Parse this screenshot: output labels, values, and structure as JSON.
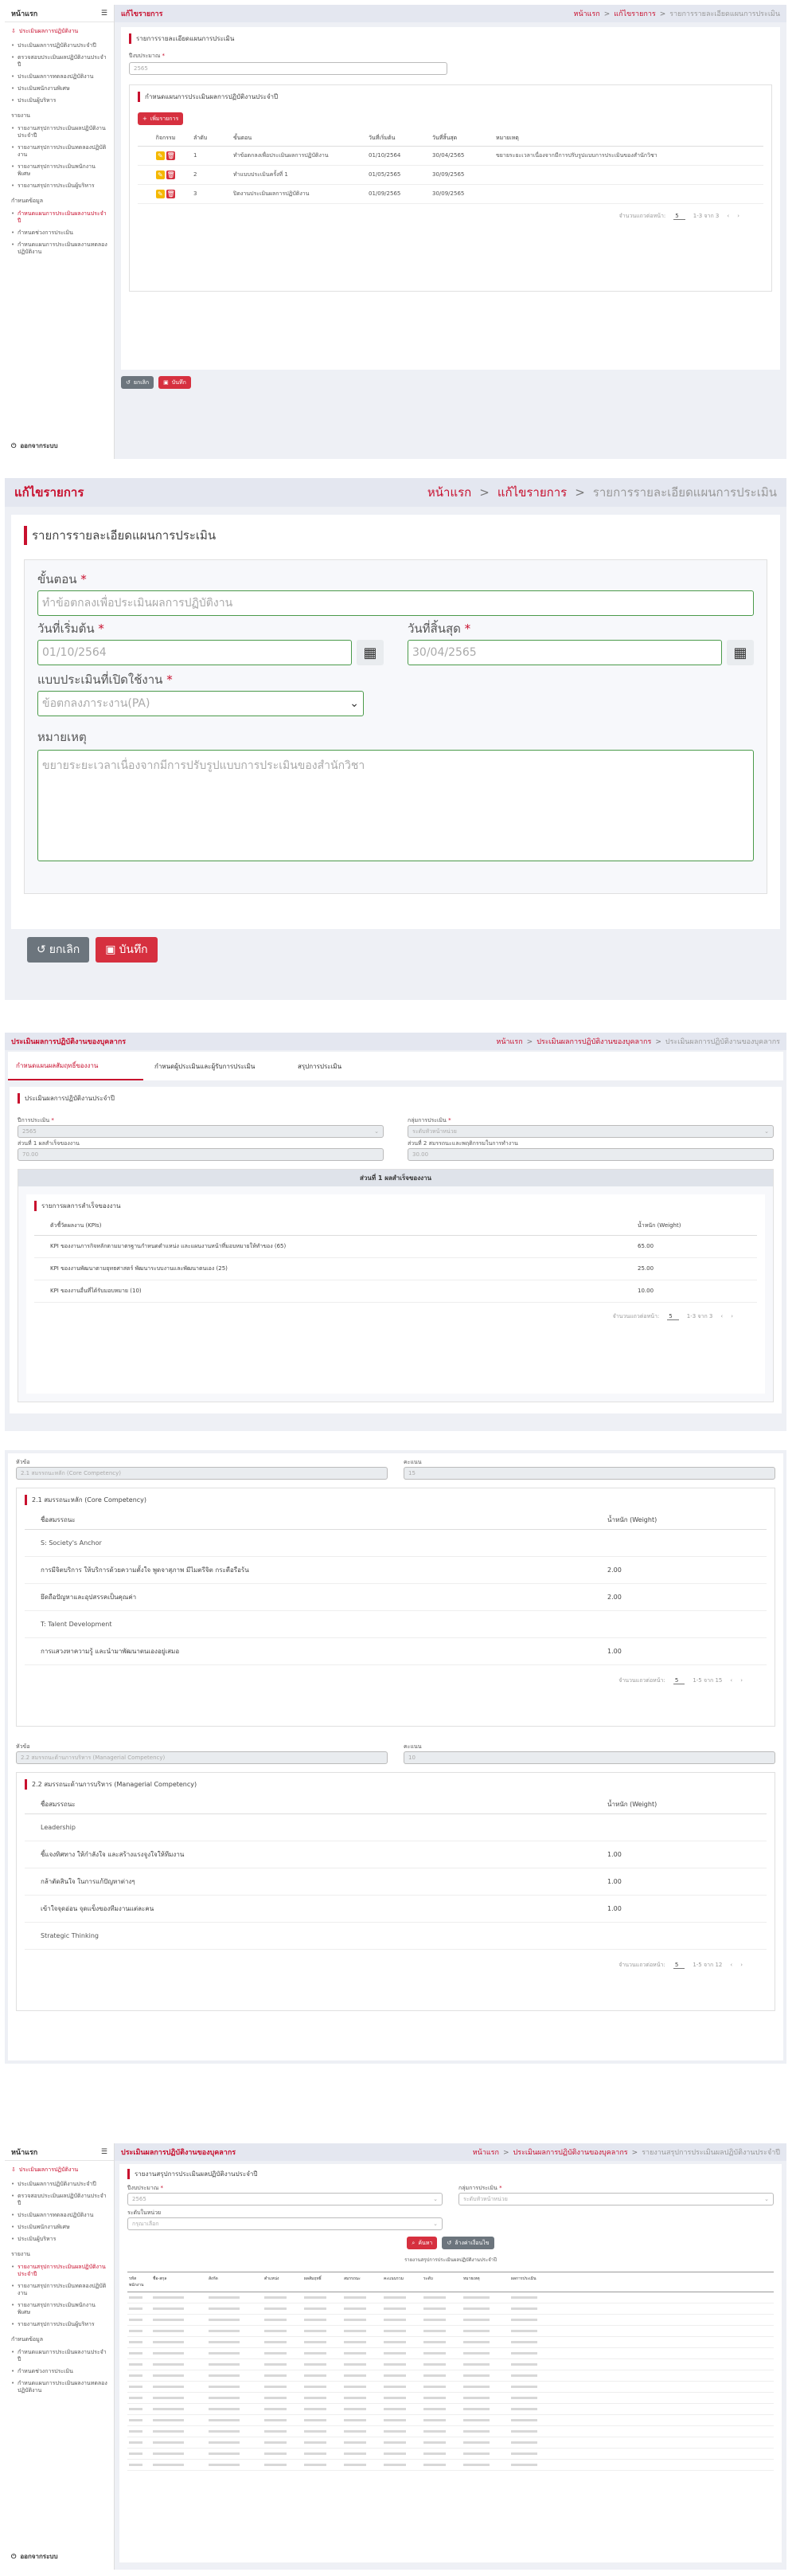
{
  "p1": {
    "brand": "หน้าแรก",
    "sidebar_main": "ประเมินผลการปฏิบัติงาน",
    "sidebar_items": [
      "ประเมินผลการปฏิบัติงานประจำปี",
      "ตรวจสอบประเมินผลปฏิบัติงานประจำปี",
      "ประเมินผลการทดลองปฏิบัติงาน",
      "ประเมินพนักงานพิเศษ",
      "ประเมินผู้บริหาร"
    ],
    "group_report": "รายงาน",
    "report_items": [
      "รายงานสรุปการประเมินผลปฏิบัติงานประจำปี",
      "รายงานสรุปการประเมินทดลองปฏิบัติงาน",
      "รายงานสรุปการประเมินพนักงานพิเศษ",
      "รายงานสรุปการประเมินผู้บริหาร"
    ],
    "group_settings": "กำหนดข้อมูล",
    "settings_items": [
      "กำหนดแผนการประเมินผลงานประจำปี",
      "กำหนดช่วงการประเมิน",
      "กำหนดแผนการประเมินผลงานทดลองปฏิบัติงาน"
    ],
    "logout": "ออกจากระบบ",
    "topbar_title": "แก้ไขรายการ",
    "crumbs": [
      "หน้าแรก",
      "แก้ไขรายการ",
      "รายการรายละเอียดแผนการประเมิน"
    ],
    "section": "รายการรายละเอียดแผนการประเมิน",
    "year_label": "ปีงบประมาณ",
    "year_value": "2565",
    "sub_section": "กำหนดแผนการประเมินผลการปฏิบัติงานประจำปี",
    "add_button": "เพิ่มรายการ",
    "columns": [
      "กิจกรรม",
      "ลำดับ",
      "ขั้นตอน",
      "วันที่เริ่มต้น",
      "วันที่สิ้นสุด",
      "หมายเหตุ"
    ],
    "rows": [
      {
        "no": "1",
        "step": "ทำข้อตกลงเพื่อประเมินผลการปฏิบัติงาน",
        "start": "01/10/2564",
        "end": "30/04/2565",
        "note": "ขยายระยะเวลาเนื่องจากมีการปรับรูปแบบการประเมินของสำนักวิชา"
      },
      {
        "no": "2",
        "step": "ทำแบบประเมินครั้งที่ 1",
        "start": "01/05/2565",
        "end": "30/09/2565",
        "note": ""
      },
      {
        "no": "3",
        "step": "ปิดงานประเมินผลการปฏิบัติงาน",
        "start": "01/09/2565",
        "end": "30/09/2565",
        "note": ""
      }
    ],
    "pager_label": "จำนวนแถวต่อหน้า:",
    "pager_size": "5",
    "pager_range": "1-3 จาก 3",
    "cancel": "ยกเลิก",
    "save": "บันทึก"
  },
  "p2": {
    "topbar_title": "แก้ไขรายการ",
    "crumbs": [
      "หน้าแรก",
      "แก้ไขรายการ",
      "รายการรายละเอียดแผนการประเมิน"
    ],
    "section": "รายการรายละเอียดแผนการประเมิน",
    "step_label": "ขั้นตอน",
    "step_value": "ทำข้อตกลงเพื่อประเมินผลการปฏิบัติงาน",
    "start_label": "วันที่เริ่มต้น",
    "start_value": "01/10/2564",
    "end_label": "วันที่สิ้นสุด",
    "end_value": "30/04/2565",
    "form_label": "แบบประเมินที่เปิดใช้งาน",
    "form_value": "ข้อตกลงภาระงาน(PA)",
    "note_label": "หมายเหตุ",
    "note_value": "ขยายระยะเวลาเนื่องจากมีการปรับรูปแบบการประเมินของสำนักวิชา",
    "cancel": "ยกเลิก",
    "save": "บันทึก"
  },
  "p3": {
    "topbar_title": "ประเมินผลการปฏิบัติงานของบุคลากร",
    "crumbs": [
      "หน้าแรก",
      "ประเมินผลการปฏิบัติงานของบุคลากร",
      "ประเมินผลการปฏิบัติงานของบุคลากร"
    ],
    "steps": [
      "กำหนดแผนผลสัมฤทธิ์ของงาน",
      "กำหนดผู้ประเมินและผู้รับการประเมิน",
      "สรุปการประเมิน"
    ],
    "section": "ประเมินผลการปฏิบัติงานประจำปี",
    "year_label": "ปีการประเมิน",
    "year_value": "2565",
    "group_label": "กลุ่มการประเมิน",
    "group_value": "ระดับหัวหน้าหน่วย",
    "part1_label": "ส่วนที่ 1 ผลสำเร็จของงาน",
    "part1_value": "70.00",
    "part2_label": "ส่วนที่ 2 สมรรถนะและพฤติกรรมในการทำงาน",
    "part2_value": "30.00",
    "box_title": "ส่วนที่ 1 ผลสำเร็จของงาน",
    "sub_title": "รายการผลการสำเร็จของงาน",
    "col_kpi": "ตัวชี้วัดผลงาน (KPIs)",
    "col_weight": "น้ำหนัก (Weight)",
    "kpis": [
      {
        "name": "KPI ของงานภารกิจหลักตามมาตรฐานกำหนดตำแหน่ง และแผนงานหน้าที่มอบหมายให้ทำของ (65)",
        "w": "65.00"
      },
      {
        "name": "KPI ของงานพัฒนาตามยุทธศาสตร์ พัฒนาระบบงานและพัฒนาตนเอง (25)",
        "w": "25.00"
      },
      {
        "name": "KPI ของงานอื่นที่ได้รับมอบหมาย (10)",
        "w": "10.00"
      }
    ],
    "pager_label": "จำนวนแถวต่อหน้า:",
    "pager_size": "5",
    "pager_range": "1-3 จาก 3"
  },
  "p4": {
    "topic_label": "หัวข้อ",
    "score_label": "คะแนน",
    "t1_value": "2.1 สมรรถนะหลัก (Core Competency)",
    "t1_score": "15",
    "t1_title": "2.1 สมรรถนะหลัก (Core Competency)",
    "col_comp": "ชื่อสมรรถนะ",
    "col_weight": "น้ำหนัก (Weight)",
    "t1_rows": [
      {
        "name": "S: Society's Anchor",
        "w": "",
        "head": true
      },
      {
        "name": "การมีจิตบริการ ให้บริการด้วยความตั้งใจ พูดจาสุภาพ มีไมตรีจิต กระตือรือร้น",
        "w": "2.00"
      },
      {
        "name": "ยึดถือปัญหาและอุปสรรคเป็นคุณค่า",
        "w": "2.00"
      },
      {
        "name": "T: Talent Development",
        "w": "",
        "head": true
      },
      {
        "name": "การแสวงหาความรู้ และนำมาพัฒนาตนเองอยู่เสมอ",
        "w": "1.00"
      }
    ],
    "t1_range": "1-5 จาก 15",
    "t2_value": "2.2 สมรรถนะด้านการบริหาร (Managerial Competency)",
    "t2_score": "10",
    "t2_title": "2.2 สมรรถนะด้านการบริหาร (Managerial Competency)",
    "t2_rows": [
      {
        "name": "Leadership",
        "w": "",
        "head": true
      },
      {
        "name": "ชี้แจงทิศทาง ให้กำลังใจ และสร้างแรงจูงใจให้ทีมงาน",
        "w": "1.00"
      },
      {
        "name": "กล้าตัดสินใจ ในการแก้ปัญหาต่างๆ",
        "w": "1.00"
      },
      {
        "name": "เข้าใจจุดอ่อน จุดแข็งของทีมงานแต่ละคน",
        "w": "1.00"
      },
      {
        "name": "Strategic Thinking",
        "w": "",
        "head": true
      }
    ],
    "t2_range": "1-5 จาก 12",
    "pager_label": "จำนวนแถวต่อหน้า:",
    "pager_size": "5"
  },
  "p5": {
    "topbar_title": "ประเมินผลการปฏิบัติงานของบุคลากร",
    "crumbs": [
      "หน้าแรก",
      "ประเมินผลการปฏิบัติงานของบุคลากร",
      "รายงานสรุปการประเมินผลปฏิบัติงานประจำปี"
    ],
    "section": "รายงานสรุปการประเมินผลปฏิบัติงานประจำปี",
    "year_label": "ปีงบประมาณ",
    "year_value": "2565",
    "group_label": "กลุ่มการประเมิน",
    "group_value": "ระดับหัวหน้าหน่วย",
    "unit_label": "ระดับในหน่วย",
    "unit_value": "กรุณาเลือก",
    "search": "ค้นหา",
    "clear": "ล้างค่าเงื่อนไข",
    "report_caption": "รายงานสรุปการประเมินผลปฏิบัติงานประจำปี",
    "columns": [
      "รหัสพนักงาน",
      "ชื่อ-สกุล",
      "สังกัด",
      "ตำแหน่ง",
      "ผลสัมฤทธิ์",
      "สมรรถนะ",
      "คะแนนรวม",
      "ระดับ",
      "หมายเหตุ",
      "ผลการประเมิน"
    ]
  }
}
